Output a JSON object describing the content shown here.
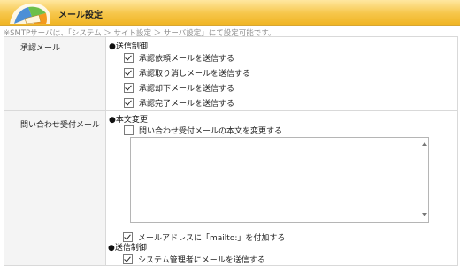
{
  "header": {
    "title": "メール設定",
    "logo_icon": "mail-settings-logo-icon"
  },
  "note": "※SMTPサーバは、「システム ＞ サイト設定 ＞ サーバ設定」にて設定可能です。",
  "approval_mail": {
    "label": "承認メール",
    "section": "●送信制御",
    "options": [
      {
        "label": "承認依頼メールを送信する",
        "checked": true
      },
      {
        "label": "承認取り消しメールを送信する",
        "checked": true
      },
      {
        "label": "承認却下メールを送信する",
        "checked": true
      },
      {
        "label": "承認完了メールを送信する",
        "checked": true
      }
    ]
  },
  "inquiry_mail": {
    "label": "問い合わせ受付メール",
    "body_section": "●本文変更",
    "change_body": {
      "label": "問い合わせ受付メールの本文を変更する",
      "checked": false
    },
    "body_text": "",
    "mailto": {
      "label": "メールアドレスに「mailto:」を付加する",
      "checked": true
    },
    "send_section": "●送信制御",
    "send_admin": {
      "label": "システム管理者にメールを送信する",
      "checked": true
    }
  }
}
